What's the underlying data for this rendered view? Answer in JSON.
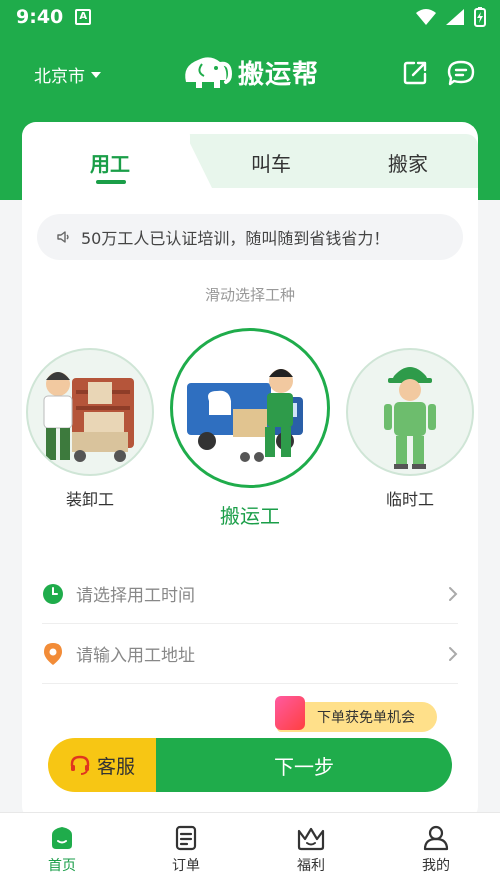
{
  "status_bar": {
    "time": "9:40",
    "notification_icon": "A"
  },
  "header": {
    "city": "北京市",
    "app_name": "搬运帮"
  },
  "tabs": [
    {
      "label": "用工",
      "active": true
    },
    {
      "label": "叫车",
      "active": false
    },
    {
      "label": "搬家",
      "active": false
    }
  ],
  "notice": {
    "text": "50万工人已认证培训，随叫随到省钱省力！"
  },
  "swipe_hint": "滑动选择工种",
  "workers": [
    {
      "label": "装卸工",
      "selected": false
    },
    {
      "label": "搬运工",
      "selected": true
    },
    {
      "label": "临时工",
      "selected": false
    }
  ],
  "fields": {
    "time_placeholder": "请选择用工时间",
    "address_placeholder": "请输入用工地址"
  },
  "promo": {
    "text": "下单获免单机会"
  },
  "actions": {
    "customer_service": "客服",
    "next": "下一步"
  },
  "bottom_nav": [
    {
      "label": "首页",
      "icon": "home-icon",
      "active": true
    },
    {
      "label": "订单",
      "icon": "orders-icon",
      "active": false
    },
    {
      "label": "福利",
      "icon": "crown-icon",
      "active": false
    },
    {
      "label": "我的",
      "icon": "profile-icon",
      "active": false
    }
  ],
  "colors": {
    "brand_green": "#1fac4b",
    "accent_yellow": "#f7c614",
    "location_orange": "#f28c38"
  }
}
